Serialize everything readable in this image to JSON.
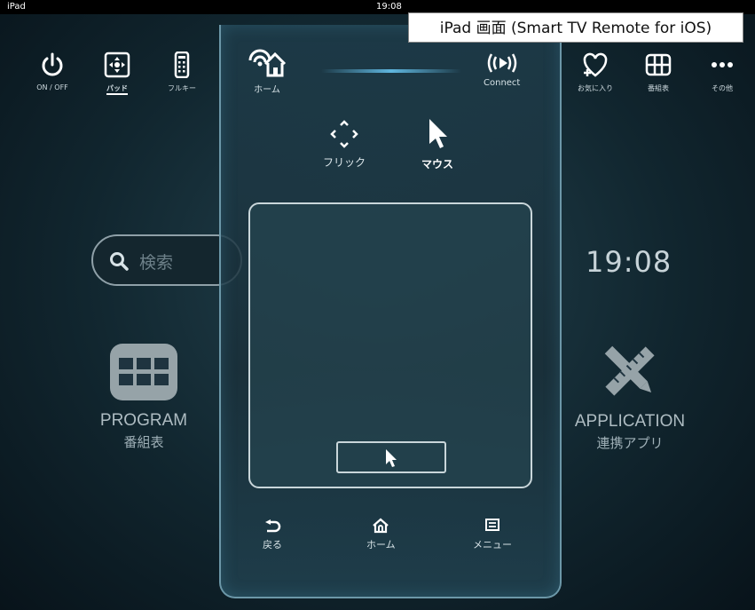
{
  "status_bar": {
    "carrier": "iPad",
    "time": "19:08"
  },
  "caption": "iPad 画面 (Smart TV Remote for iOS)",
  "left_toolbar": [
    {
      "label": "ON / OFF",
      "icon": "power-icon"
    },
    {
      "label": "パッド",
      "icon": "dpad-icon",
      "active": true
    },
    {
      "label": "フルキー",
      "icon": "full-remote-icon"
    }
  ],
  "right_toolbar": [
    {
      "label": "お気に入り",
      "icon": "favorite-add-icon"
    },
    {
      "label": "番組表",
      "icon": "grid-icon"
    },
    {
      "label": "その他",
      "icon": "more-icon"
    }
  ],
  "search": {
    "placeholder": "検索"
  },
  "clock": "19:08",
  "tiles": {
    "program": {
      "en": "PROGRAM",
      "jp": "番組表"
    },
    "application": {
      "en": "APPLICATION",
      "jp": "連携アプリ"
    }
  },
  "panel": {
    "home_label": "ホーム",
    "connect_label": "Connect",
    "modes": {
      "flick": "フリック",
      "mouse": "マウス",
      "selected": "mouse"
    },
    "bottom": {
      "back": "戻る",
      "home": "ホーム",
      "menu": "メニュー"
    }
  },
  "colors": {
    "accent": "#5fb6df",
    "panel_border": "#6c97a8"
  }
}
